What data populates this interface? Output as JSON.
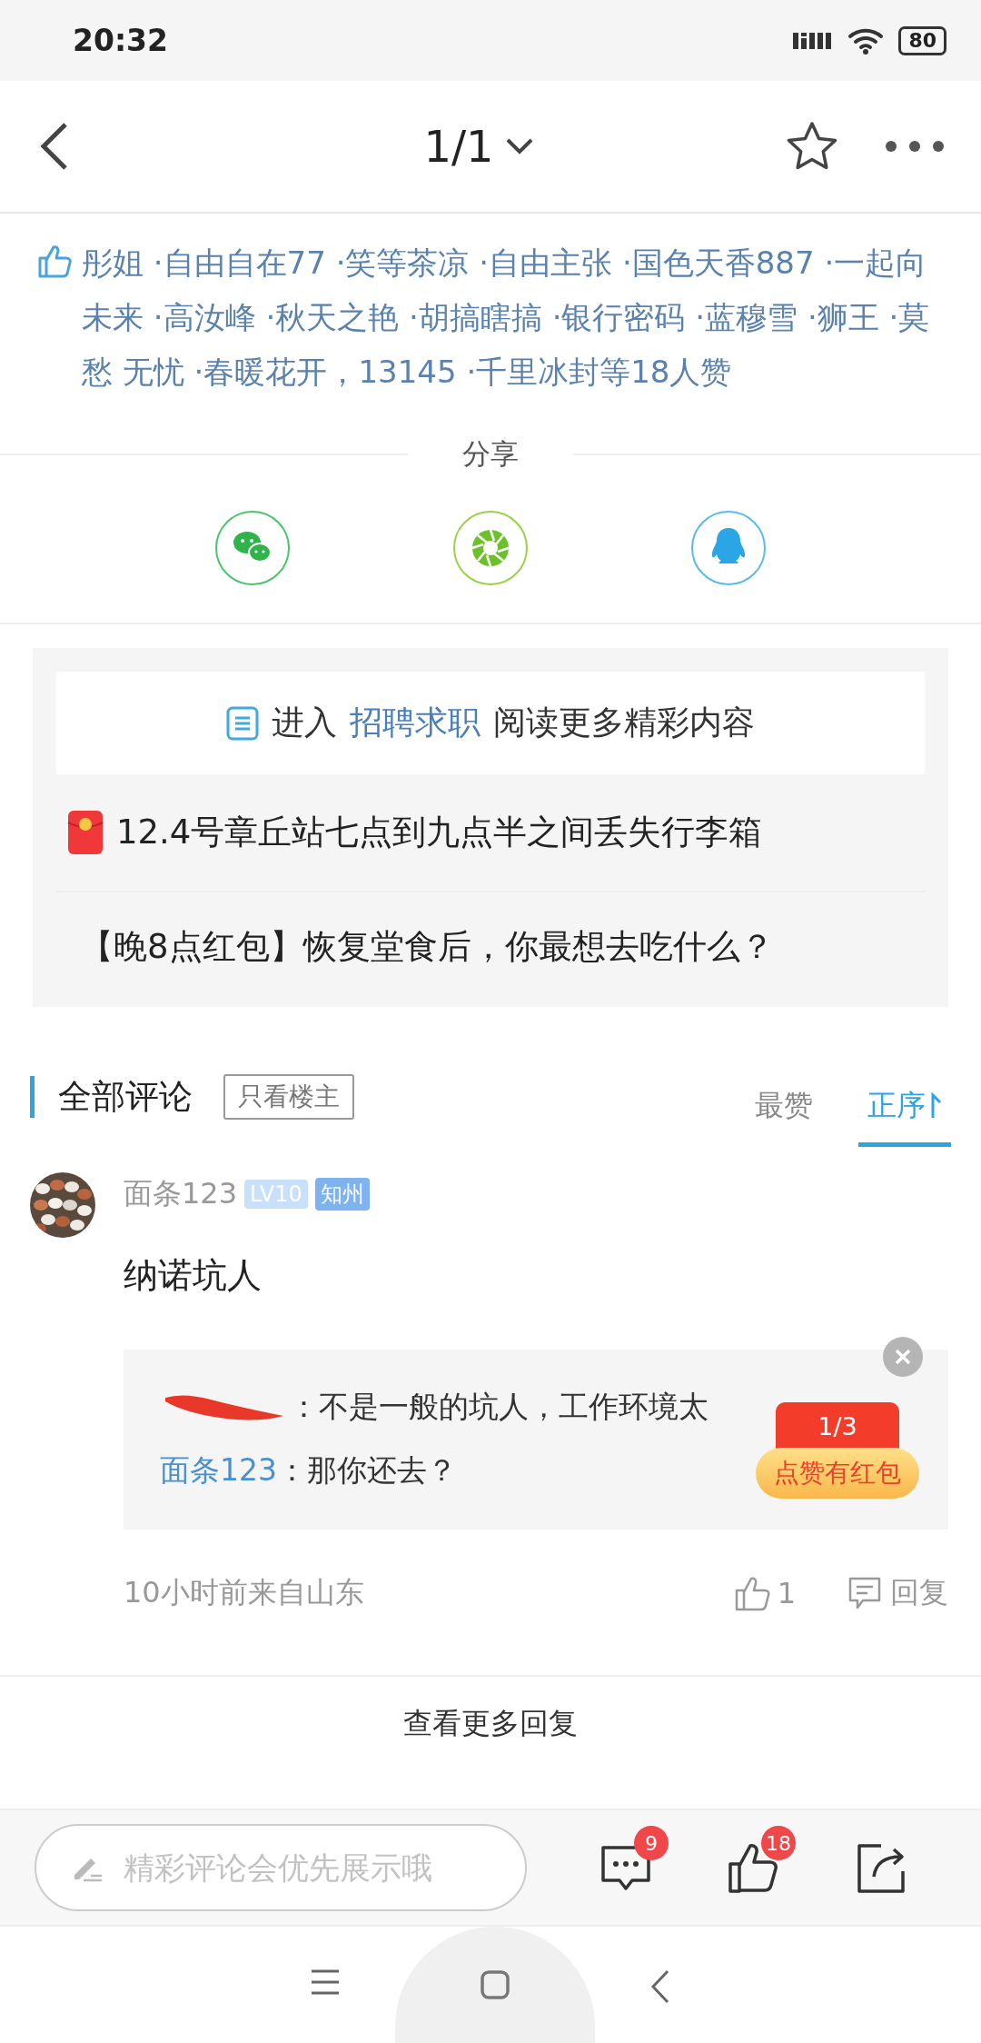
{
  "status_bar": {
    "time": "20:32",
    "battery": "80"
  },
  "header": {
    "page_indicator": "1/1",
    "favorited": false
  },
  "likes": {
    "text": "彤姐 ·自由自在77 ·笑等茶凉 ·自由主张 ·国色天香887 ·一起向未来 ·高汝峰 ·秋天之艳 ·胡搞瞎搞 ·银行密码 ·蓝穆雪 ·狮王 ·莫愁 无忧 ·春暖花开，13145 ·千里冰封等18人赞"
  },
  "share": {
    "title": "分享",
    "targets": [
      {
        "kind": "wechat"
      },
      {
        "kind": "moments"
      },
      {
        "kind": "qq"
      }
    ]
  },
  "topic_card": {
    "banner": {
      "prefix": "进入",
      "link": "招聘求职",
      "suffix": "阅读更多精彩内容"
    },
    "posts": [
      {
        "kind": "red_packet",
        "title": "12.4号章丘站七点到九点半之间丢失行李箱"
      },
      {
        "kind": "plain",
        "title": "【晚8点红包】恢复堂食后，你最想去吃什么？"
      }
    ]
  },
  "comments": {
    "title": "全部评论",
    "filter_button": "只看楼主",
    "sorts": [
      {
        "label": "最赞",
        "selected": false
      },
      {
        "label": "正序",
        "selected": true
      }
    ],
    "items": [
      {
        "user": "面条123",
        "level": "LV10",
        "rank": "知州",
        "text": "纳诺坑人",
        "replies": [
          {
            "redacted": true,
            "text": "：不是一般的坑人，工作环境太"
          },
          {
            "redacted": false,
            "user": "面条123",
            "text": "：那你还去？"
          }
        ],
        "promo": {
          "counter": "1/3",
          "label": "点赞有红包"
        },
        "meta": "10小时前来自山东",
        "like_count": "1",
        "reply_label": "回复"
      }
    ],
    "more_replies": "查看更多回复"
  },
  "bottom_bar": {
    "placeholder": "精彩评论会优先展示哦",
    "comment_count": "9",
    "like_count": "18"
  }
}
